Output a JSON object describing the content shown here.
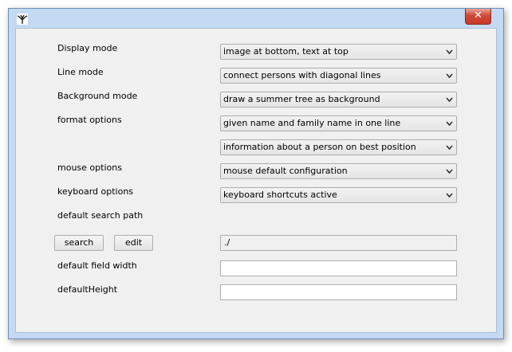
{
  "window": {
    "close_glyph": "✕"
  },
  "settings": {
    "display_mode": {
      "label": "Display mode",
      "value": "image at bottom, text at top"
    },
    "line_mode": {
      "label": "Line mode",
      "value": "connect persons with diagonal lines"
    },
    "background_mode": {
      "label": "Background mode",
      "value": "draw a summer tree as background"
    },
    "format_options": {
      "label": "format options",
      "value_1": "given name and family name in one line",
      "value_2": "information about a person on best position"
    },
    "mouse_options": {
      "label": "mouse options",
      "value": "mouse default configuration"
    },
    "keyboard_options": {
      "label": "keyboard options",
      "value": "keyboard shortcuts active"
    },
    "default_search_path": {
      "label": "default search path",
      "search_button": "search",
      "edit_button": "edit",
      "value": "./"
    },
    "default_field_width": {
      "label": "default field width",
      "value": ""
    },
    "default_height": {
      "label": "defaultHeight",
      "value": ""
    }
  },
  "icons": {
    "app": "tree-icon",
    "close": "close-icon",
    "dropdown": "chevron-down-icon"
  }
}
